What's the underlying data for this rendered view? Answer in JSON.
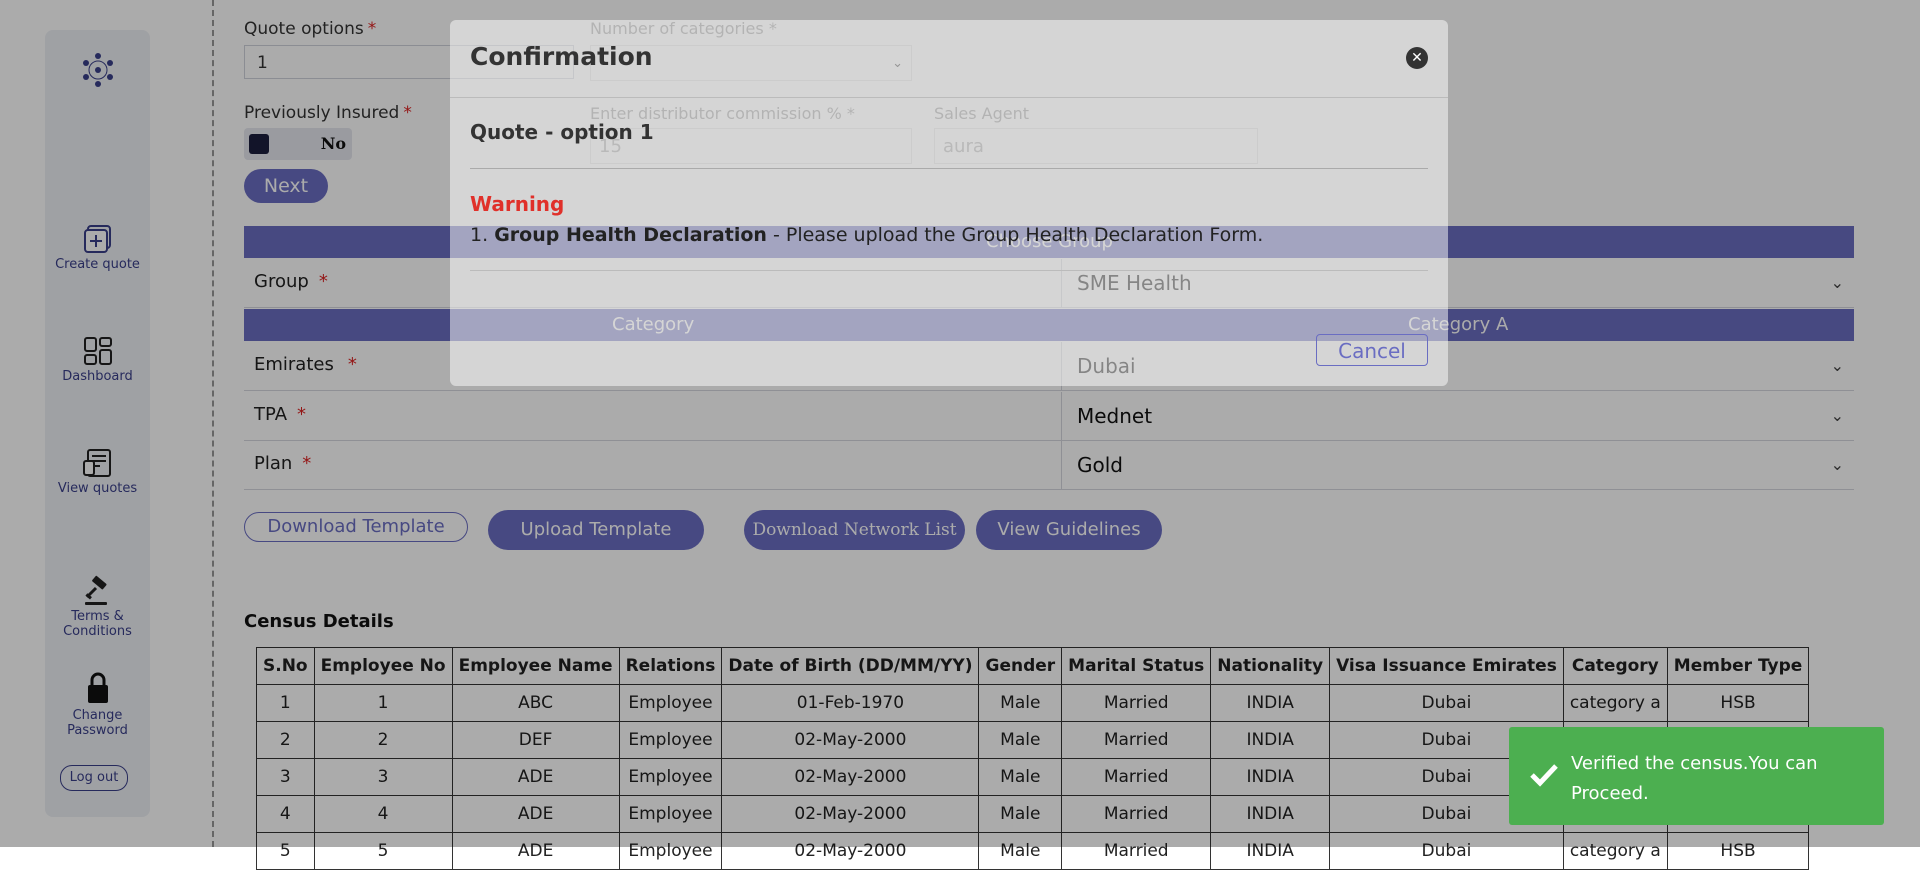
{
  "sidebar": {
    "items": [
      {
        "label": "Create quote"
      },
      {
        "label": "Dashboard"
      },
      {
        "label": "View quotes"
      },
      {
        "label": "Terms & Conditions"
      },
      {
        "label": "Change Password"
      }
    ],
    "logout": "Log out"
  },
  "form": {
    "quote_options_label": "Quote options",
    "quote_options_value": "1",
    "previously_insured_label": "Previously Insured",
    "previously_insured_value": "No",
    "next_button": "Next",
    "choose_group_band": "Choose Group",
    "group_label": "Group",
    "group_value": "SME Health",
    "category_band_left": "Category",
    "category_band_right": "Category A",
    "emirates_label": "Emirates",
    "emirates_value": "Dubai",
    "tpa_label": "TPA",
    "tpa_value": "Mednet",
    "plan_label": "Plan",
    "plan_value": "Gold",
    "required_mark": "*"
  },
  "actions": {
    "download_template": "Download Template",
    "upload_template": "Upload Template",
    "download_network_list": "Download Network List",
    "view_guidelines": "View Guidelines"
  },
  "ghost_fields": {
    "num_categories_label": "Number of categories *",
    "commission_label": "Enter distributor commission % *",
    "commission_value": "15",
    "sales_agent_label": "Sales Agent",
    "sales_agent_value": "aura"
  },
  "census": {
    "title": "Census Details",
    "headers": [
      "S.No",
      "Employee No",
      "Employee Name",
      "Relations",
      "Date of Birth (DD/MM/YY)",
      "Gender",
      "Marital Status",
      "Nationality",
      "Visa Issuance Emirates",
      "Category",
      "Member Type"
    ],
    "rows": [
      [
        "1",
        "1",
        "ABC",
        "Employee",
        "01-Feb-1970",
        "Male",
        "Married",
        "INDIA",
        "Dubai",
        "category a",
        "HSB"
      ],
      [
        "2",
        "2",
        "DEF",
        "Employee",
        "02-May-2000",
        "Male",
        "Married",
        "INDIA",
        "Dubai",
        "",
        ""
      ],
      [
        "3",
        "3",
        "ADE",
        "Employee",
        "02-May-2000",
        "Male",
        "Married",
        "INDIA",
        "Dubai",
        "",
        ""
      ],
      [
        "4",
        "4",
        "ADE",
        "Employee",
        "02-May-2000",
        "Male",
        "Married",
        "INDIA",
        "Dubai",
        "",
        ""
      ],
      [
        "5",
        "5",
        "ADE",
        "Employee",
        "02-May-2000",
        "Male",
        "Married",
        "INDIA",
        "Dubai",
        "category a",
        "HSB"
      ]
    ]
  },
  "modal": {
    "title": "Confirmation",
    "subtitle": "Quote - option 1",
    "warning_title": "Warning",
    "warning_num": "1.",
    "warning_bold": "Group Health Declaration",
    "warning_text": " - Please upload the Group Health Declaration Form.",
    "cancel": "Cancel"
  },
  "toast": {
    "message": "Verified the census.You can Proceed."
  },
  "colors": {
    "brand": "#6a6dc2",
    "toast": "#4caf50",
    "warning": "#e0302a"
  }
}
